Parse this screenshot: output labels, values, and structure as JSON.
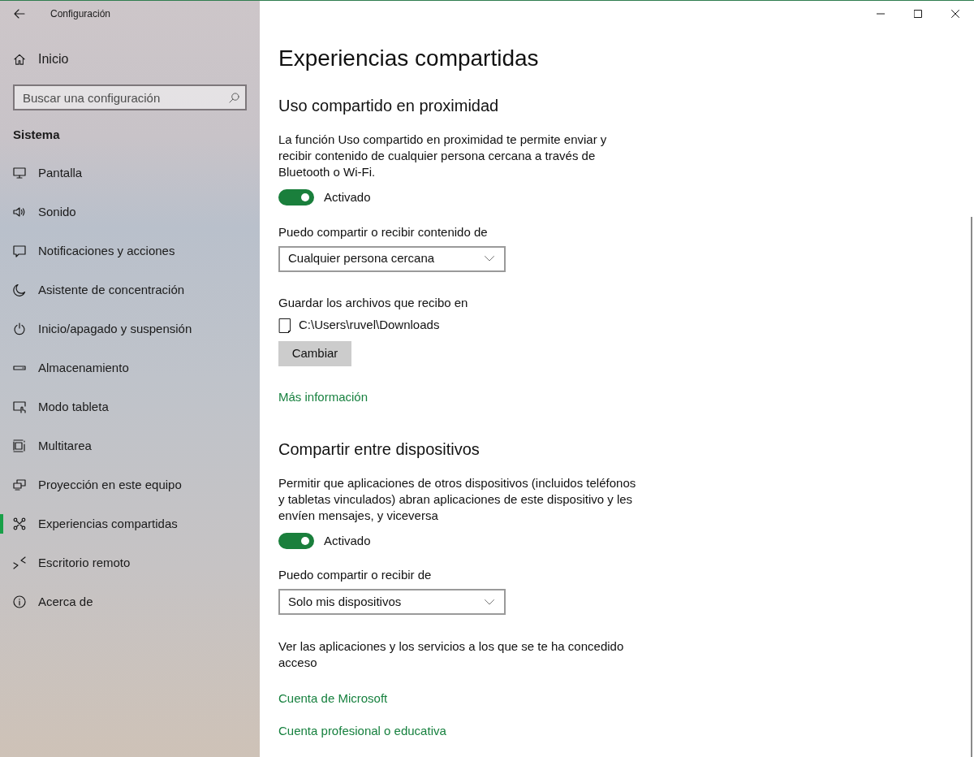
{
  "window": {
    "title": "Configuración"
  },
  "sidebar": {
    "home": "Inicio",
    "search": {
      "placeholder": "Buscar una configuración"
    },
    "section": "Sistema",
    "items": [
      {
        "label": "Pantalla",
        "selected": false
      },
      {
        "label": "Sonido",
        "selected": false
      },
      {
        "label": "Notificaciones y acciones",
        "selected": false
      },
      {
        "label": "Asistente de concentración",
        "selected": false
      },
      {
        "label": "Inicio/apagado y suspensión",
        "selected": false
      },
      {
        "label": "Almacenamiento",
        "selected": false
      },
      {
        "label": "Modo tableta",
        "selected": false
      },
      {
        "label": "Multitarea",
        "selected": false
      },
      {
        "label": "Proyección en este equipo",
        "selected": false
      },
      {
        "label": "Experiencias compartidas",
        "selected": true
      },
      {
        "label": "Escritorio remoto",
        "selected": false
      },
      {
        "label": "Acerca de",
        "selected": false
      }
    ]
  },
  "page": {
    "title": "Experiencias compartidas",
    "sections": [
      {
        "heading": "Uso compartido en proximidad",
        "description": "La función Uso compartido en proximidad te permite enviar y recibir contenido de cualquier persona cercana a través de Bluetooth o Wi-Fi.",
        "toggle": {
          "on": true,
          "label": "Activado"
        },
        "dropdown": {
          "label": "Puedo compartir o recibir contenido de",
          "value": "Cualquier persona cercana"
        },
        "save_location": {
          "label": "Guardar los archivos que recibo en",
          "path": "C:\\Users\\ruvel\\Downloads",
          "button": "Cambiar"
        },
        "links": [
          "Más información"
        ]
      },
      {
        "heading": "Compartir entre dispositivos",
        "description": "Permitir que aplicaciones de otros dispositivos (incluidos teléfonos y tabletas vinculados) abran aplicaciones de este dispositivo y les envíen mensajes, y viceversa",
        "toggle": {
          "on": true,
          "label": "Activado"
        },
        "dropdown": {
          "label": "Puedo compartir o recibir de",
          "value": "Solo mis dispositivos"
        },
        "note": "Ver las aplicaciones y los servicios a los que se te ha concedido acceso",
        "links": [
          "Cuenta de Microsoft",
          "Cuenta profesional o educativa"
        ]
      }
    ]
  }
}
